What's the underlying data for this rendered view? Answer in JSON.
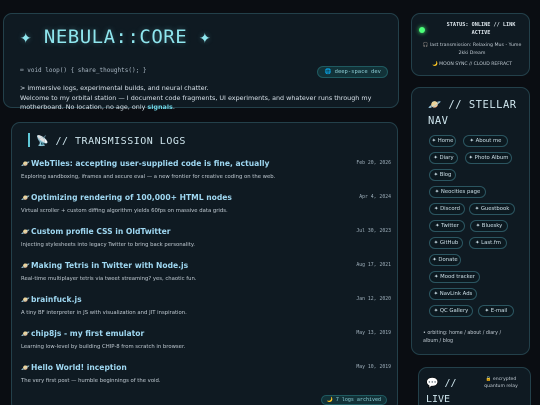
{
  "header": {
    "logo": "✦ NEBULA::CORE ✦",
    "code_line": "⌨ void loop() { share_thoughts(); }",
    "tag": "🌐 deep-space dev",
    "intro_line1": "> immersive logs, experimental builds, and neural chatter.",
    "intro_line2": "Welcome to my orbital station — I document code fragments, UI experiments, and whatever runs through my motherboard. No location, no age, only ",
    "intro_link": "signals",
    "intro_end": "."
  },
  "logs": {
    "title": "📡 // TRANSMISSION LOGS",
    "count": "🌙 7 logs archived",
    "posts": [
      {
        "title": "WebTiles: accepting user-supplied code is fine, actually",
        "date": "Feb 20, 2026",
        "desc": "Exploring sandboxing, iframes and secure eval — a new frontier for creative coding on the web."
      },
      {
        "title": "Optimizing rendering of 100,000+ HTML nodes",
        "date": "Apr 4, 2024",
        "desc": "Virtual scroller + custom diffing algorithm yields 60fps on massive data grids."
      },
      {
        "title": "Custom profile CSS in OldTwitter",
        "date": "Jul 30, 2023",
        "desc": "Injecting stylesheets into legacy Twitter to bring back personality."
      },
      {
        "title": "Making Tetris in Twitter with Node.js",
        "date": "Aug 17, 2021",
        "desc": "Real-time multiplayer tetris via tweet streaming? yes, chaotic fun."
      },
      {
        "title": "brainfuck.js",
        "date": "Jan 12, 2020",
        "desc": "A tiny BF interpreter in JS with visualization and JIT inspiration."
      },
      {
        "title": "chip8js - my first emulator",
        "date": "May 13, 2019",
        "desc": "Learning low-level by building CHIP-8 from scratch in browser."
      },
      {
        "title": "Hello World! inception",
        "date": "May 10, 2019",
        "desc": "The very first post — humble beginnings of the void."
      }
    ]
  },
  "status": {
    "line1": "STATUS: ONLINE // LINK",
    "line2": "ACTIVE",
    "transmission1": "🎧 last transmission: Relaxing Mus - Yume",
    "transmission2": "2kki Dream",
    "moon_sync": "🌙 MOON SYNC // CLOUD REFRACT"
  },
  "nav": {
    "title": "🪐 // STELLAR NAV",
    "items": [
      {
        "label": "✦ Home"
      },
      {
        "label": "✦ About me"
      },
      {
        "label": "✦ Diary"
      },
      {
        "label": "✦ Photo Album"
      },
      {
        "label": "✦ Blog"
      },
      {
        "label": "✦ Neocities page"
      },
      {
        "label": "✦ Discord"
      },
      {
        "label": "✦ Guestbook"
      },
      {
        "label": "✦ Twitter"
      },
      {
        "label": "✦ Bluesky"
      },
      {
        "label": "✦ GitHub"
      },
      {
        "label": "✦ Last.fm"
      },
      {
        "label": "✦ Donate"
      },
      {
        "label": "✦ Mood tracker"
      },
      {
        "label": "✦ NavLink Ads"
      },
      {
        "label": "✦ QC Gallery"
      },
      {
        "label": "✦ E-mail"
      }
    ],
    "orbiting1": "• orbiting: home / about / diary /",
    "orbiting2": "album / blog"
  },
  "live": {
    "title1": "💬 //",
    "title2": "LIVE",
    "encrypted1": "🔒 encrypted",
    "encrypted2": "quantum relay"
  },
  "colors": {
    "accent": "#8fe6ee",
    "status_online": "#4cff7a",
    "link": "#6fd6e6"
  }
}
